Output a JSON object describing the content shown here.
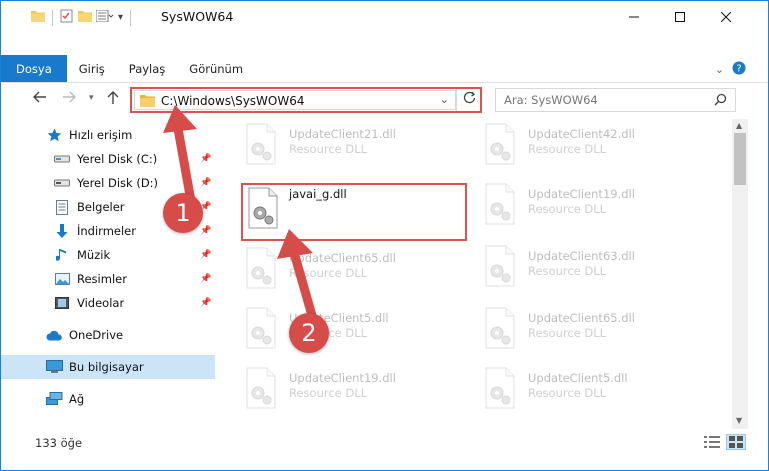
{
  "window": {
    "title": "SysWOW64"
  },
  "ribbon": {
    "tabs": [
      {
        "label": "Dosya",
        "active": true
      },
      {
        "label": "Giriş",
        "active": false
      },
      {
        "label": "Paylaş",
        "active": false
      },
      {
        "label": "Görünüm",
        "active": false
      }
    ]
  },
  "navigation": {
    "address": "C:\\Windows\\SysWOW64",
    "search_placeholder": "Ara: SysWOW64"
  },
  "sidebar": {
    "items": [
      {
        "label": "Hızlı erişim",
        "icon": "star-icon",
        "pinned": false
      },
      {
        "label": "Yerel Disk (C:)",
        "icon": "drive-icon",
        "pinned": true
      },
      {
        "label": "Yerel Disk (D:)",
        "icon": "drive-icon",
        "pinned": true
      },
      {
        "label": "Belgeler",
        "icon": "document-icon",
        "pinned": true
      },
      {
        "label": "İndirmeler",
        "icon": "download-icon",
        "pinned": true
      },
      {
        "label": "Müzik",
        "icon": "music-icon",
        "pinned": true
      },
      {
        "label": "Resimler",
        "icon": "pictures-icon",
        "pinned": true
      },
      {
        "label": "Videolar",
        "icon": "video-icon",
        "pinned": true
      },
      {
        "label": "OneDrive",
        "icon": "cloud-icon",
        "pinned": false
      },
      {
        "label": "Bu bilgisayar",
        "icon": "computer-icon",
        "pinned": false,
        "selected": true
      },
      {
        "label": "Ağ",
        "icon": "network-icon",
        "pinned": false
      }
    ]
  },
  "files": {
    "left": [
      {
        "name": "UpdateClient21.dll",
        "type": "Resource DLL"
      },
      {
        "name": "javai_g.dll",
        "type": ""
      },
      {
        "name": "UpdateClient65.dll",
        "type": "Resource DLL"
      },
      {
        "name": "UpdateClient5.dll",
        "type": "Resource DLL"
      },
      {
        "name": "UpdateClient19.dll",
        "type": "Resource DLL"
      }
    ],
    "right": [
      {
        "name": "UpdateClient42.dll",
        "type": "Resource DLL"
      },
      {
        "name": "UpdateClient19.dll",
        "type": "Resource DLL"
      },
      {
        "name": "UpdateClient63.dll",
        "type": "Resource DLL"
      },
      {
        "name": "UpdateClient65.dll",
        "type": "Resource DLL"
      },
      {
        "name": "UpdateClient5.dll",
        "type": "Resource DLL"
      }
    ]
  },
  "status": {
    "item_count": "133 öğe"
  },
  "annotations": {
    "step1": "1",
    "step2": "2"
  },
  "colors": {
    "accent": "#1979ca",
    "highlight": "#d9534f",
    "selected": "#cce4f7"
  }
}
